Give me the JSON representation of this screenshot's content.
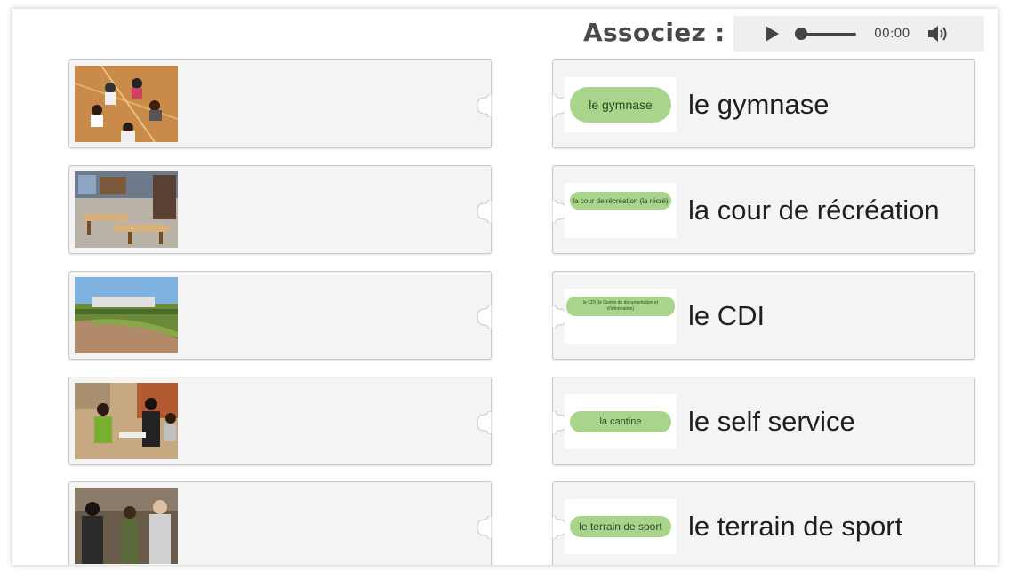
{
  "header": {
    "title": "Associez :"
  },
  "player": {
    "time": "00:00"
  },
  "left_cards": [
    {
      "image": "gym-photo"
    },
    {
      "image": "library-photo"
    },
    {
      "image": "schoolyard-photo"
    },
    {
      "image": "cafeteria-photo"
    },
    {
      "image": "students-photo"
    }
  ],
  "right_cards": [
    {
      "tag": "le gymnase",
      "label": "le gymnase"
    },
    {
      "tag": "la cour de récréation (la récré)",
      "label": "la cour de récréation"
    },
    {
      "tag": "le CDI (le Centre de documentation et d'information)",
      "label": "le CDI"
    },
    {
      "tag": "la cantine",
      "label": "le self service"
    },
    {
      "tag": "le terrain de sport",
      "label": "le terrain de sport"
    }
  ]
}
